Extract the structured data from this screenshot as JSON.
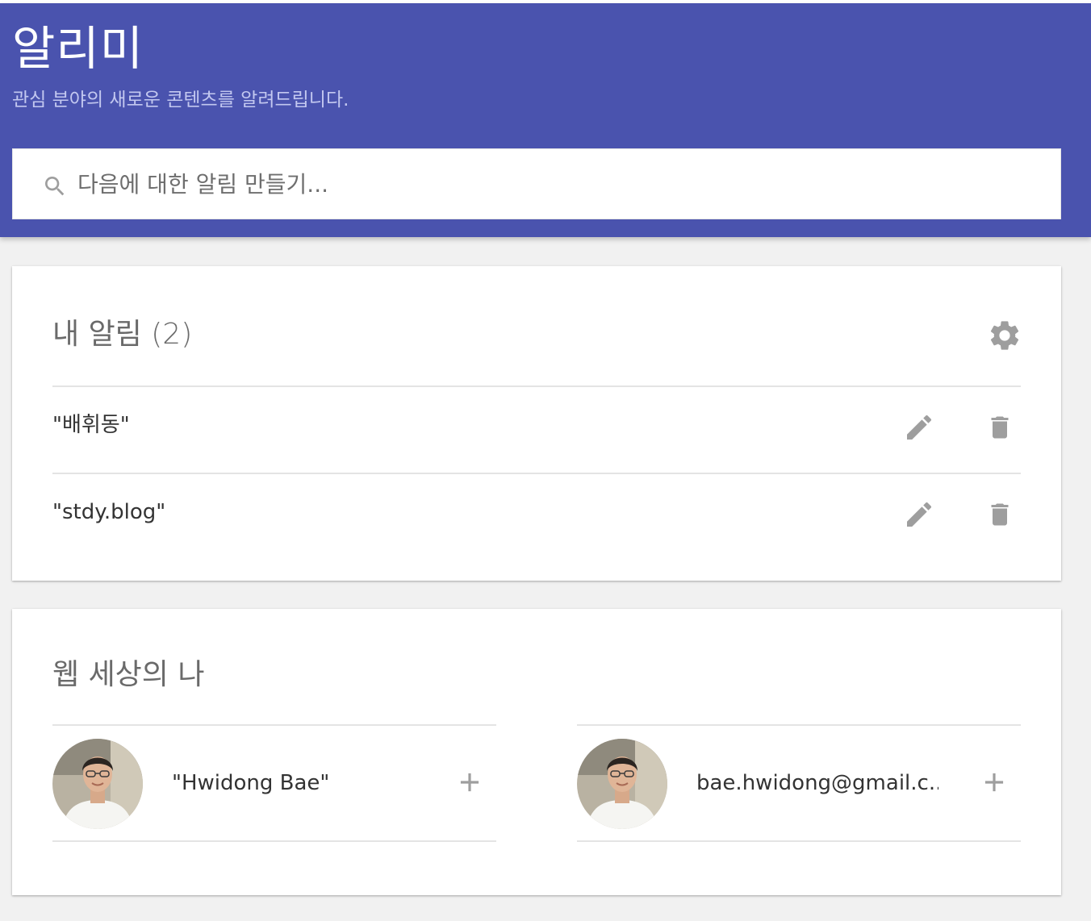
{
  "header": {
    "title": "알리미",
    "subtitle": "관심 분야의 새로운 콘텐츠를 알려드립니다.",
    "brand_color": "#4a53ae"
  },
  "search": {
    "placeholder": "다음에 대한 알림 만들기...",
    "value": "",
    "icon": "search-icon"
  },
  "my_alerts": {
    "title": "내 알림 (2)",
    "settings_icon": "gear-icon",
    "items": [
      {
        "label": "\"배휘동\"",
        "edit_icon": "pencil-icon",
        "delete_icon": "trash-icon"
      },
      {
        "label": "\"stdy.blog\"",
        "edit_icon": "pencil-icon",
        "delete_icon": "trash-icon"
      }
    ]
  },
  "me_on_web": {
    "title": "웹 세상의 나",
    "items": [
      {
        "label": "\"Hwidong Bae\"",
        "add_icon": "plus-icon",
        "avatar": "avatar-photo"
      },
      {
        "label": "bae.hwidong@gmail.c...",
        "add_icon": "plus-icon",
        "avatar": "avatar-photo"
      }
    ]
  }
}
